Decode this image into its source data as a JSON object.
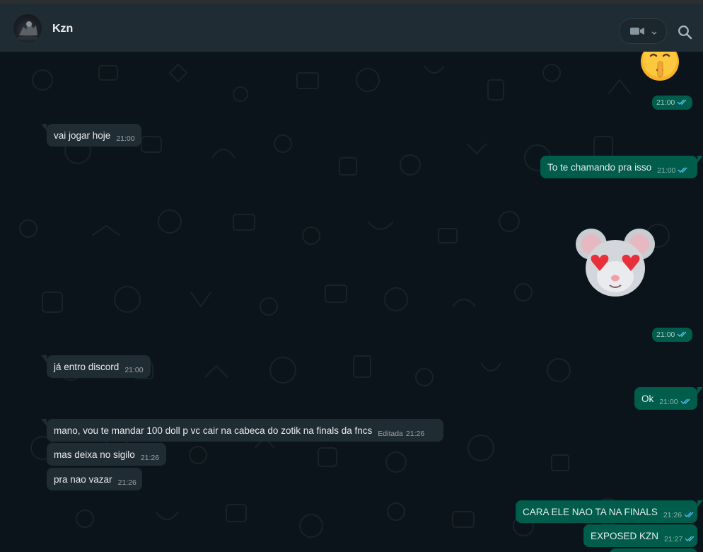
{
  "header": {
    "contact_name": "Kzn"
  },
  "icons": {
    "video": "video-camera-icon",
    "search": "search-icon",
    "read": "double-check-icon"
  },
  "colors": {
    "incoming_bubble": "#202c33",
    "outgoing_bubble": "#005c4b",
    "read_ticks": "#53bdeb",
    "header_bg": "#1f2c33",
    "chat_bg": "#0b141a"
  },
  "messages": [
    {
      "direction": "out",
      "kind": "sticker",
      "sticker": "shushing-face-emoji",
      "time": "21:00",
      "status": "read"
    },
    {
      "direction": "in",
      "text": "vai jogar hoje",
      "time": "21:00"
    },
    {
      "direction": "out",
      "text": "To te chamando pra isso",
      "time": "21:00",
      "status": "read"
    },
    {
      "direction": "out",
      "kind": "sticker",
      "sticker": "mouse-heart-eyes-sticker",
      "time": "21:00",
      "status": "read"
    },
    {
      "direction": "in",
      "text": "já entro discord",
      "time": "21:00"
    },
    {
      "direction": "out",
      "text": "Ok",
      "time": "21:00",
      "status": "read"
    },
    {
      "direction": "in",
      "text": "mano, vou te mandar 100 doll p vc cair na cabeca do zotik na finals da fncs",
      "edited_label": "Editada",
      "time": "21:26"
    },
    {
      "direction": "in",
      "text": "mas deixa no sigilo",
      "time": "21:26"
    },
    {
      "direction": "in",
      "text": "pra nao vazar",
      "time": "21:26"
    },
    {
      "direction": "out",
      "text": "CARA ELE NAO TA NA FINALS",
      "time": "21:26",
      "status": "read"
    },
    {
      "direction": "out",
      "text": "EXPOSED KZN",
      "time": "21:27",
      "status": "read"
    }
  ]
}
